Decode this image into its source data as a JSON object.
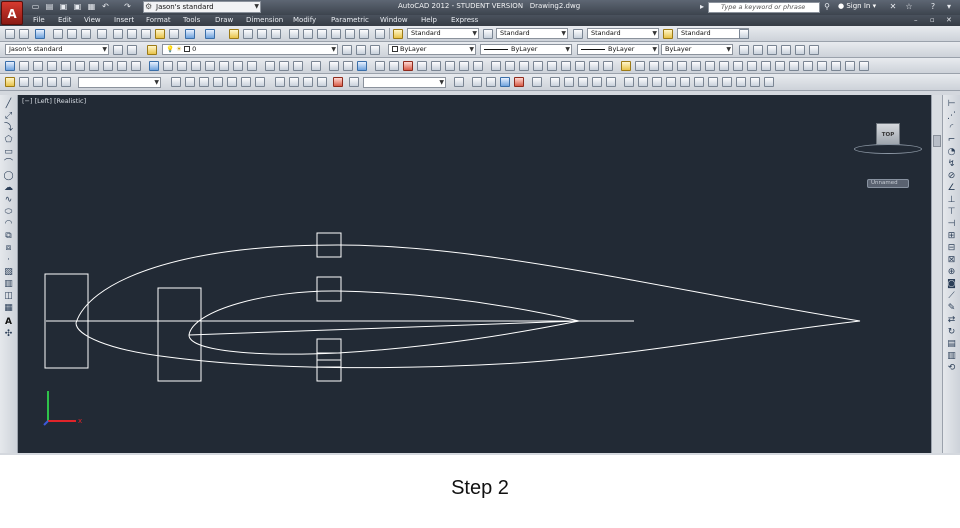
{
  "title_bar": {
    "app_title": "AutoCAD 2012 - STUDENT VERSION",
    "file_name": "Drawing2.dwg",
    "workspace": "Jason's standard",
    "search_placeholder": "Type a keyword or phrase",
    "sign_in": "Sign In"
  },
  "menu": {
    "items": [
      "File",
      "Edit",
      "View",
      "Insert",
      "Format",
      "Tools",
      "Draw",
      "Dimension",
      "Modify",
      "Parametric",
      "Window",
      "Help",
      "Express"
    ]
  },
  "styles_toolbar": {
    "text_style": "Standard",
    "dim_style": "Standard",
    "table_style": "Standard",
    "mleader_style": "Standard"
  },
  "workspace_toolbar": {
    "workspace": "Jason's standard",
    "layer": "0",
    "color": "ByLayer",
    "linetype": "ByLayer",
    "lineweight": "ByLayer",
    "plotstyle": "ByLayer"
  },
  "viewport": {
    "label": "[−] [Left] [Realistic]",
    "viewcube_face": "TOP",
    "named_view": "Unnamed"
  },
  "icons": {
    "app_logo": "autocad-logo-icon",
    "search": "search-icon",
    "user": "user-icon",
    "help": "help-icon",
    "gear": "gear-icon"
  },
  "colors": {
    "canvas_bg": "#222a35",
    "drawing_lines": "#ffffff",
    "ucs_x": "#e0242a",
    "ucs_y": "#2ec24a",
    "ucs_z": "#3c59d8"
  },
  "caption": "Step 2"
}
